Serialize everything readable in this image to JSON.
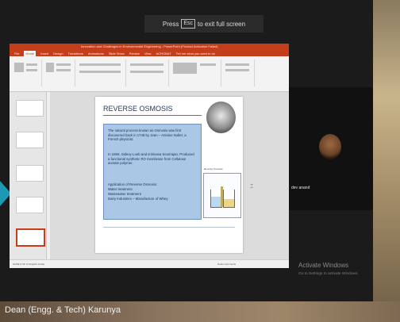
{
  "fullscreen_hint": {
    "before": "Press",
    "key": "Esc",
    "after": "to exit full screen"
  },
  "powerpoint": {
    "window_title": "Innovation and Challenges in Environmental Engineering - PowerPoint (Product Activation Failed)",
    "tabs": [
      "File",
      "Home",
      "Insert",
      "Design",
      "Transitions",
      "Animations",
      "Slide Show",
      "Review",
      "View",
      "ACROBAT",
      "Tell me what you want to do"
    ],
    "active_tab_index": 1,
    "status_text": "SLIDE 6 OF 11   English (India)",
    "zoom_text": "Notes   Comments",
    "slide": {
      "title": "REVERSE OSMOSIS",
      "paragraph1": "The natural process known as Osmosis was first discovered back in 1748 by Jean – Antoine Nollet, a French physicist.",
      "paragraph2": "In 1959, Sidney Loeb and srinivasa Sourirajan, Produced a functional synthetic RO membrane from Cellulose acetate polymer.",
      "applications_heading": "Application of Reverse Osmosis:",
      "applications": [
        "Water treatment",
        "Wastewater treatment",
        "Dairy Industries – Manufacture of Whey"
      ],
      "figure_label": "Reverse Osmosis"
    }
  },
  "participant": {
    "name": "dev anand"
  },
  "presenter_name": "Dean (Engg. & Tech) Karunya",
  "windows_activation": {
    "title": "Activate Windows",
    "subtitle": "Go to Settings to activate Windows."
  },
  "colors": {
    "ppt_accent": "#c43e1c",
    "slide_box": "#aac7e6",
    "slide_title": "#243a5e"
  }
}
